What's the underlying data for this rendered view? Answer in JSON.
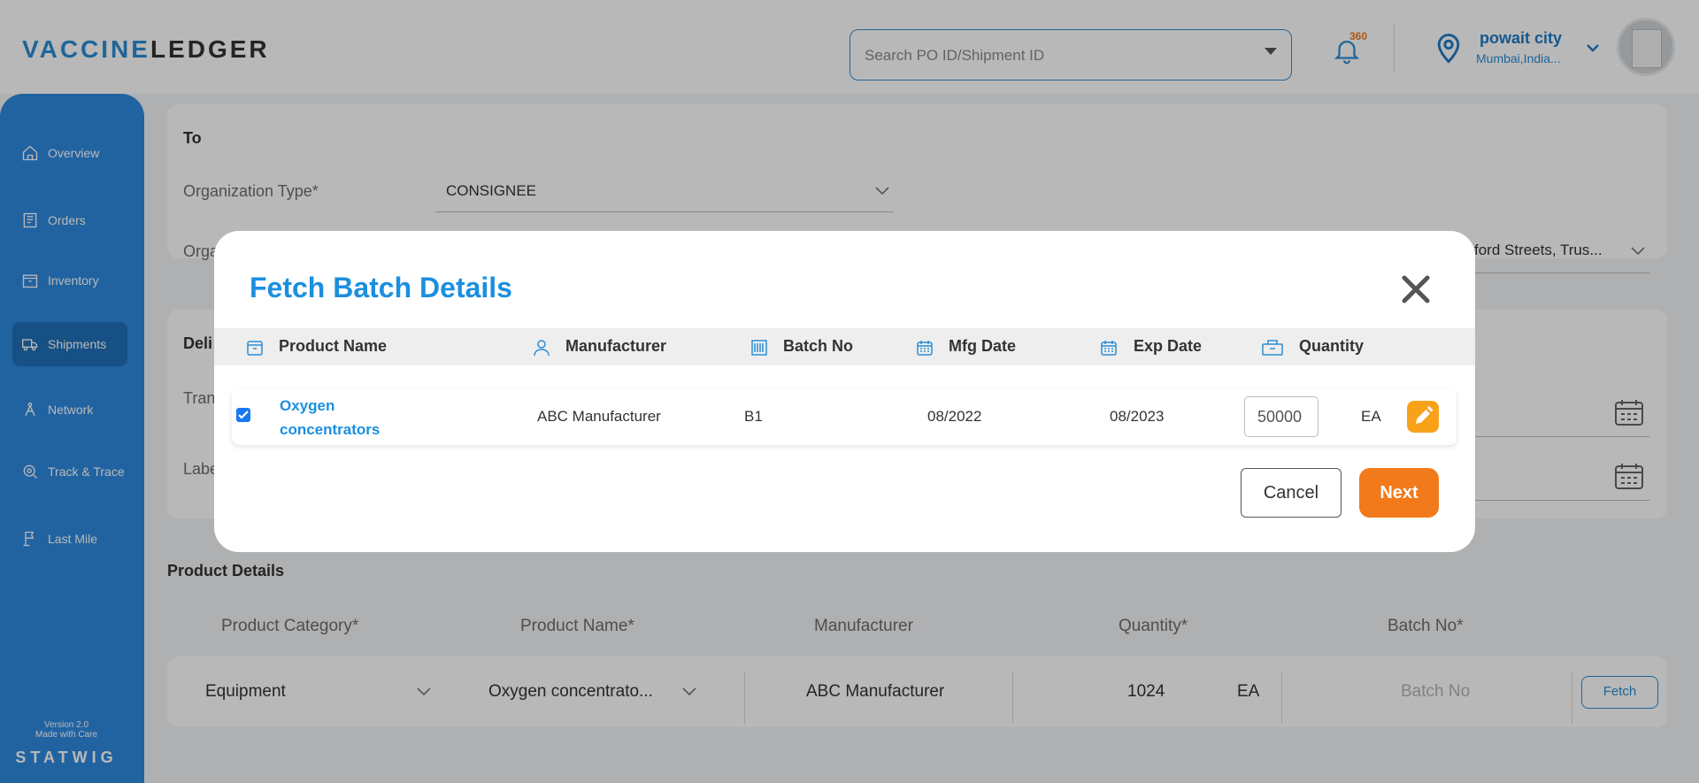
{
  "header": {
    "logo_part1": "VACCINE",
    "logo_part2": "LEDGER",
    "search_placeholder": "Search PO ID/Shipment ID",
    "notification_count": "360",
    "location_name": "powait city",
    "location_sub": "Mumbai,India..."
  },
  "sidebar": {
    "items": [
      {
        "label": "Overview",
        "icon": "home-icon"
      },
      {
        "label": "Orders",
        "icon": "orders-icon"
      },
      {
        "label": "Inventory",
        "icon": "inventory-icon"
      },
      {
        "label": "Shipments",
        "icon": "truck-icon",
        "active": true
      },
      {
        "label": "Network",
        "icon": "network-icon"
      },
      {
        "label": "Track & Trace",
        "icon": "track-icon"
      },
      {
        "label": "Last Mile",
        "icon": "last-mile-icon"
      }
    ],
    "version": "Version 2.0",
    "made_with": "Made with Care",
    "brand": "STATWIG"
  },
  "to_section": {
    "title": "To",
    "org_type_label": "Organization Type*",
    "org_type_value": "CONSIGNEE",
    "org_label_partial": "Orga",
    "address_partial": "ford Streets, Trus..."
  },
  "delivery_section": {
    "title_partial": "Deli",
    "transit_partial": "Tran",
    "label_partial": "Labe"
  },
  "product_details": {
    "title": "Product Details",
    "columns": [
      "Product Category*",
      "Product Name*",
      "Manufacturer",
      "Quantity*",
      "Batch No*"
    ],
    "row": {
      "category": "Equipment",
      "product_name": "Oxygen concentrato...",
      "manufacturer": "ABC Manufacturer",
      "quantity": "1024",
      "unit": "EA",
      "batch_placeholder": "Batch No",
      "fetch_label": "Fetch"
    }
  },
  "modal": {
    "title": "Fetch Batch Details",
    "columns": [
      "Product Name",
      "Manufacturer",
      "Batch No",
      "Mfg Date",
      "Exp Date",
      "Quantity"
    ],
    "row": {
      "product_line1": "Oxygen",
      "product_line2": "concentrators",
      "manufacturer": "ABC Manufacturer",
      "batch_no": "B1",
      "mfg_date": "08/2022",
      "exp_date": "08/2023",
      "quantity": "50000",
      "unit": "EA",
      "checked": true
    },
    "cancel_label": "Cancel",
    "next_label": "Next"
  },
  "colors": {
    "brand_blue": "#1b8fe0",
    "sidebar_blue": "#2f8ae0",
    "accent_orange": "#f27a1a",
    "edit_yellow": "#f8a21a"
  }
}
